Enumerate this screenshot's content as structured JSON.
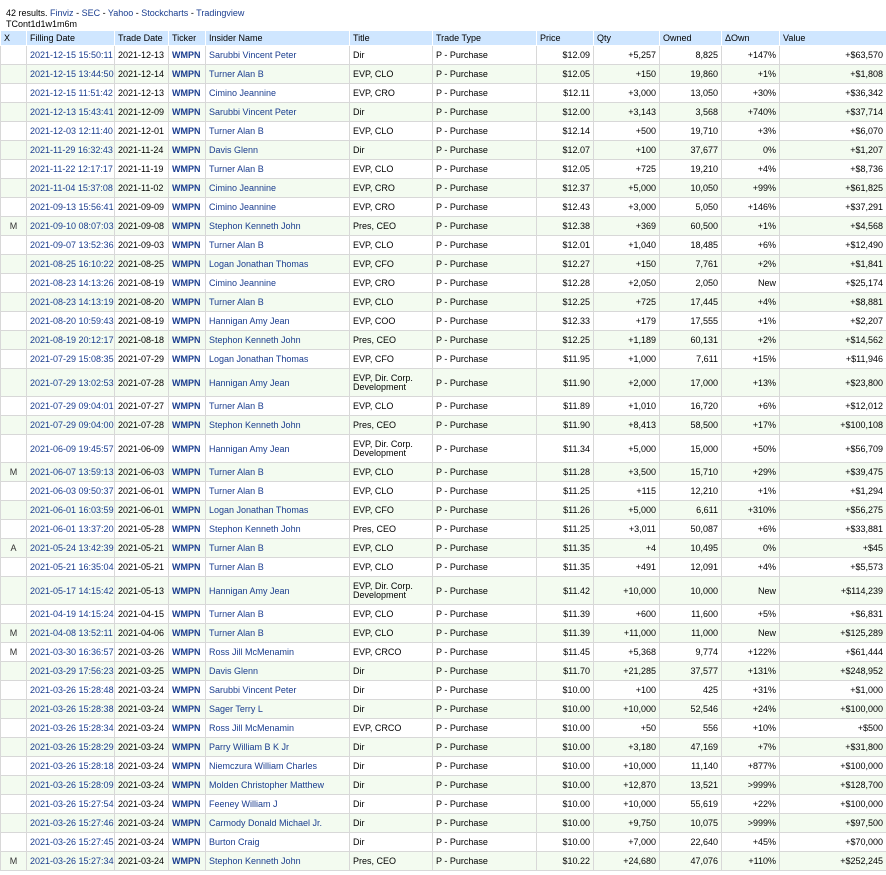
{
  "header": {
    "results_text": "42 results.",
    "links": [
      "Finviz",
      "SEC",
      "Yahoo",
      "Stockcharts",
      "Tradingview"
    ],
    "separator": " - ",
    "sub_line": "TCont1d1w1m6m"
  },
  "table": {
    "columns": [
      "X",
      "Filling Date",
      "Trade Date",
      "Ticker",
      "Insider Name",
      "Title",
      "Trade Type",
      "Price",
      "Qty",
      "Owned",
      "ΔOwn",
      "Value"
    ],
    "rows": [
      [
        "",
        "2021-12-15 15:50:11",
        "2021-12-13",
        "WMPN",
        "Sarubbi Vincent Peter",
        "Dir",
        "P - Purchase",
        "$12.09",
        "+5,257",
        "8,825",
        "+147%",
        "+$63,570"
      ],
      [
        "",
        "2021-12-15 13:44:50",
        "2021-12-14",
        "WMPN",
        "Turner Alan B",
        "EVP, CLO",
        "P - Purchase",
        "$12.05",
        "+150",
        "19,860",
        "+1%",
        "+$1,808"
      ],
      [
        "",
        "2021-12-15 11:51:42",
        "2021-12-13",
        "WMPN",
        "Cimino Jeannine",
        "EVP, CRO",
        "P - Purchase",
        "$12.11",
        "+3,000",
        "13,050",
        "+30%",
        "+$36,342"
      ],
      [
        "",
        "2021-12-13 15:43:41",
        "2021-12-09",
        "WMPN",
        "Sarubbi Vincent Peter",
        "Dir",
        "P - Purchase",
        "$12.00",
        "+3,143",
        "3,568",
        "+740%",
        "+$37,714"
      ],
      [
        "",
        "2021-12-03 12:11:40",
        "2021-12-01",
        "WMPN",
        "Turner Alan B",
        "EVP, CLO",
        "P - Purchase",
        "$12.14",
        "+500",
        "19,710",
        "+3%",
        "+$6,070"
      ],
      [
        "",
        "2021-11-29 16:32:43",
        "2021-11-24",
        "WMPN",
        "Davis Glenn",
        "Dir",
        "P - Purchase",
        "$12.07",
        "+100",
        "37,677",
        "0%",
        "+$1,207"
      ],
      [
        "",
        "2021-11-22 12:17:17",
        "2021-11-19",
        "WMPN",
        "Turner Alan B",
        "EVP, CLO",
        "P - Purchase",
        "$12.05",
        "+725",
        "19,210",
        "+4%",
        "+$8,736"
      ],
      [
        "",
        "2021-11-04 15:37:08",
        "2021-11-02",
        "WMPN",
        "Cimino Jeannine",
        "EVP, CRO",
        "P - Purchase",
        "$12.37",
        "+5,000",
        "10,050",
        "+99%",
        "+$61,825"
      ],
      [
        "",
        "2021-09-13 15:56:41",
        "2021-09-09",
        "WMPN",
        "Cimino Jeannine",
        "EVP, CRO",
        "P - Purchase",
        "$12.43",
        "+3,000",
        "5,050",
        "+146%",
        "+$37,291"
      ],
      [
        "M",
        "2021-09-10 08:07:03",
        "2021-09-08",
        "WMPN",
        "Stephon Kenneth John",
        "Pres, CEO",
        "P - Purchase",
        "$12.38",
        "+369",
        "60,500",
        "+1%",
        "+$4,568"
      ],
      [
        "",
        "2021-09-07 13:52:36",
        "2021-09-03",
        "WMPN",
        "Turner Alan B",
        "EVP, CLO",
        "P - Purchase",
        "$12.01",
        "+1,040",
        "18,485",
        "+6%",
        "+$12,490"
      ],
      [
        "",
        "2021-08-25 16:10:22",
        "2021-08-25",
        "WMPN",
        "Logan Jonathan Thomas",
        "EVP, CFO",
        "P - Purchase",
        "$12.27",
        "+150",
        "7,761",
        "+2%",
        "+$1,841"
      ],
      [
        "",
        "2021-08-23 14:13:26",
        "2021-08-19",
        "WMPN",
        "Cimino Jeannine",
        "EVP, CRO",
        "P - Purchase",
        "$12.28",
        "+2,050",
        "2,050",
        "New",
        "+$25,174"
      ],
      [
        "",
        "2021-08-23 14:13:19",
        "2021-08-20",
        "WMPN",
        "Turner Alan B",
        "EVP, CLO",
        "P - Purchase",
        "$12.25",
        "+725",
        "17,445",
        "+4%",
        "+$8,881"
      ],
      [
        "",
        "2021-08-20 10:59:43",
        "2021-08-19",
        "WMPN",
        "Hannigan Amy Jean",
        "EVP, COO",
        "P - Purchase",
        "$12.33",
        "+179",
        "17,555",
        "+1%",
        "+$2,207"
      ],
      [
        "",
        "2021-08-19 20:12:17",
        "2021-08-18",
        "WMPN",
        "Stephon Kenneth John",
        "Pres, CEO",
        "P - Purchase",
        "$12.25",
        "+1,189",
        "60,131",
        "+2%",
        "+$14,562"
      ],
      [
        "",
        "2021-07-29 15:08:35",
        "2021-07-29",
        "WMPN",
        "Logan Jonathan Thomas",
        "EVP, CFO",
        "P - Purchase",
        "$11.95",
        "+1,000",
        "7,611",
        "+15%",
        "+$11,946"
      ],
      [
        "",
        "2021-07-29 13:02:53",
        "2021-07-28",
        "WMPN",
        "Hannigan Amy Jean",
        "EVP, Dir. Corp. Development",
        "P - Purchase",
        "$11.90",
        "+2,000",
        "17,000",
        "+13%",
        "+$23,800"
      ],
      [
        "",
        "2021-07-29 09:04:01",
        "2021-07-27",
        "WMPN",
        "Turner Alan B",
        "EVP, CLO",
        "P - Purchase",
        "$11.89",
        "+1,010",
        "16,720",
        "+6%",
        "+$12,012"
      ],
      [
        "",
        "2021-07-29 09:04:00",
        "2021-07-28",
        "WMPN",
        "Stephon Kenneth John",
        "Pres, CEO",
        "P - Purchase",
        "$11.90",
        "+8,413",
        "58,500",
        "+17%",
        "+$100,108"
      ],
      [
        "",
        "2021-06-09 19:45:57",
        "2021-06-09",
        "WMPN",
        "Hannigan Amy Jean",
        "EVP, Dir. Corp. Development",
        "P - Purchase",
        "$11.34",
        "+5,000",
        "15,000",
        "+50%",
        "+$56,709"
      ],
      [
        "M",
        "2021-06-07 13:59:13",
        "2021-06-03",
        "WMPN",
        "Turner Alan B",
        "EVP, CLO",
        "P - Purchase",
        "$11.28",
        "+3,500",
        "15,710",
        "+29%",
        "+$39,475"
      ],
      [
        "",
        "2021-06-03 09:50:37",
        "2021-06-01",
        "WMPN",
        "Turner Alan B",
        "EVP, CLO",
        "P - Purchase",
        "$11.25",
        "+115",
        "12,210",
        "+1%",
        "+$1,294"
      ],
      [
        "",
        "2021-06-01 16:03:59",
        "2021-06-01",
        "WMPN",
        "Logan Jonathan Thomas",
        "EVP, CFO",
        "P - Purchase",
        "$11.26",
        "+5,000",
        "6,611",
        "+310%",
        "+$56,275"
      ],
      [
        "",
        "2021-06-01 13:37:20",
        "2021-05-28",
        "WMPN",
        "Stephon Kenneth John",
        "Pres, CEO",
        "P - Purchase",
        "$11.25",
        "+3,011",
        "50,087",
        "+6%",
        "+$33,881"
      ],
      [
        "A",
        "2021-05-24 13:42:39",
        "2021-05-21",
        "WMPN",
        "Turner Alan B",
        "EVP, CLO",
        "P - Purchase",
        "$11.35",
        "+4",
        "10,495",
        "0%",
        "+$45"
      ],
      [
        "",
        "2021-05-21 16:35:04",
        "2021-05-21",
        "WMPN",
        "Turner Alan B",
        "EVP, CLO",
        "P - Purchase",
        "$11.35",
        "+491",
        "12,091",
        "+4%",
        "+$5,573"
      ],
      [
        "",
        "2021-05-17 14:15:42",
        "2021-05-13",
        "WMPN",
        "Hannigan Amy Jean",
        "EVP, Dir. Corp. Development",
        "P - Purchase",
        "$11.42",
        "+10,000",
        "10,000",
        "New",
        "+$114,239"
      ],
      [
        "",
        "2021-04-19 14:15:24",
        "2021-04-15",
        "WMPN",
        "Turner Alan B",
        "EVP, CLO",
        "P - Purchase",
        "$11.39",
        "+600",
        "11,600",
        "+5%",
        "+$6,831"
      ],
      [
        "M",
        "2021-04-08 13:52:11",
        "2021-04-06",
        "WMPN",
        "Turner Alan B",
        "EVP, CLO",
        "P - Purchase",
        "$11.39",
        "+11,000",
        "11,000",
        "New",
        "+$125,289"
      ],
      [
        "M",
        "2021-03-30 16:36:57",
        "2021-03-26",
        "WMPN",
        "Ross Jill McMenamin",
        "EVP, CRCO",
        "P - Purchase",
        "$11.45",
        "+5,368",
        "9,774",
        "+122%",
        "+$61,444"
      ],
      [
        "",
        "2021-03-29 17:56:23",
        "2021-03-25",
        "WMPN",
        "Davis Glenn",
        "Dir",
        "P - Purchase",
        "$11.70",
        "+21,285",
        "37,577",
        "+131%",
        "+$248,952"
      ],
      [
        "",
        "2021-03-26 15:28:48",
        "2021-03-24",
        "WMPN",
        "Sarubbi Vincent Peter",
        "Dir",
        "P - Purchase",
        "$10.00",
        "+100",
        "425",
        "+31%",
        "+$1,000"
      ],
      [
        "",
        "2021-03-26 15:28:38",
        "2021-03-24",
        "WMPN",
        "Sager Terry L",
        "Dir",
        "P - Purchase",
        "$10.00",
        "+10,000",
        "52,546",
        "+24%",
        "+$100,000"
      ],
      [
        "",
        "2021-03-26 15:28:34",
        "2021-03-24",
        "WMPN",
        "Ross Jill McMenamin",
        "EVP, CRCO",
        "P - Purchase",
        "$10.00",
        "+50",
        "556",
        "+10%",
        "+$500"
      ],
      [
        "",
        "2021-03-26 15:28:29",
        "2021-03-24",
        "WMPN",
        "Parry William B K Jr",
        "Dir",
        "P - Purchase",
        "$10.00",
        "+3,180",
        "47,169",
        "+7%",
        "+$31,800"
      ],
      [
        "",
        "2021-03-26 15:28:18",
        "2021-03-24",
        "WMPN",
        "Niemczura William Charles",
        "Dir",
        "P - Purchase",
        "$10.00",
        "+10,000",
        "11,140",
        "+877%",
        "+$100,000"
      ],
      [
        "",
        "2021-03-26 15:28:09",
        "2021-03-24",
        "WMPN",
        "Molden Christopher Matthew",
        "Dir",
        "P - Purchase",
        "$10.00",
        "+12,870",
        "13,521",
        ">999%",
        "+$128,700"
      ],
      [
        "",
        "2021-03-26 15:27:54",
        "2021-03-24",
        "WMPN",
        "Feeney William J",
        "Dir",
        "P - Purchase",
        "$10.00",
        "+10,000",
        "55,619",
        "+22%",
        "+$100,000"
      ],
      [
        "",
        "2021-03-26 15:27:46",
        "2021-03-24",
        "WMPN",
        "Carmody Donald Michael Jr.",
        "Dir",
        "P - Purchase",
        "$10.00",
        "+9,750",
        "10,075",
        ">999%",
        "+$97,500"
      ],
      [
        "",
        "2021-03-26 15:27:45",
        "2021-03-24",
        "WMPN",
        "Burton Craig",
        "Dir",
        "P - Purchase",
        "$10.00",
        "+7,000",
        "22,640",
        "+45%",
        "+$70,000"
      ],
      [
        "M",
        "2021-03-26 15:27:34",
        "2021-03-24",
        "WMPN",
        "Stephon Kenneth John",
        "Pres, CEO",
        "P - Purchase",
        "$10.22",
        "+24,680",
        "47,076",
        "+110%",
        "+$252,245"
      ]
    ]
  }
}
